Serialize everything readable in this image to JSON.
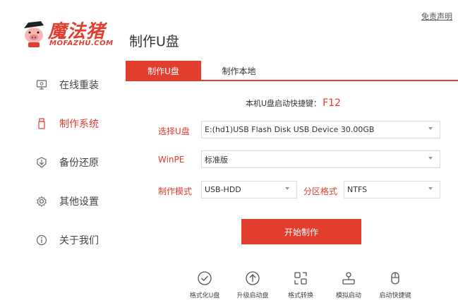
{
  "header": {
    "disclaimer": "免责声明",
    "logo_cn": "魔法猪",
    "logo_en": "MOFAZHU.COM",
    "page_title": "制作U盘"
  },
  "sidebar": {
    "items": [
      {
        "label": "在线重装",
        "icon": "monitor-icon"
      },
      {
        "label": "制作系统",
        "icon": "usb-drive-icon",
        "active": true
      },
      {
        "label": "备份还原",
        "icon": "backup-restore-icon"
      },
      {
        "label": "其他设置",
        "icon": "gear-icon"
      },
      {
        "label": "关于我们",
        "icon": "info-icon"
      }
    ]
  },
  "tabs": [
    {
      "label": "制作U盘",
      "active": true
    },
    {
      "label": "制作本地",
      "active": false
    }
  ],
  "hotkey": {
    "text": "本机U盘启动快捷键：",
    "key": "F12"
  },
  "form": {
    "usb_label": "选择U盘",
    "usb_value": "E:(hd1)USB Flash Disk USB Device 30.00GB",
    "winpe_label": "WinPE",
    "winpe_value": "标准版",
    "mode_label": "制作模式",
    "mode_value": "USB-HDD",
    "partition_label": "分区格式",
    "partition_value": "NTFS"
  },
  "start_button": "开始制作",
  "tools": [
    {
      "label": "格式化U盘",
      "icon": "check-circle-icon"
    },
    {
      "label": "升级启动盘",
      "icon": "upload-circle-icon"
    },
    {
      "label": "格式转换",
      "icon": "convert-icon"
    },
    {
      "label": "模拟启动",
      "icon": "simulate-icon"
    },
    {
      "label": "启动快捷键",
      "icon": "mouse-icon"
    }
  ],
  "colors": {
    "accent": "#e23e2e",
    "text": "#333333",
    "border": "#dcdcdc"
  }
}
